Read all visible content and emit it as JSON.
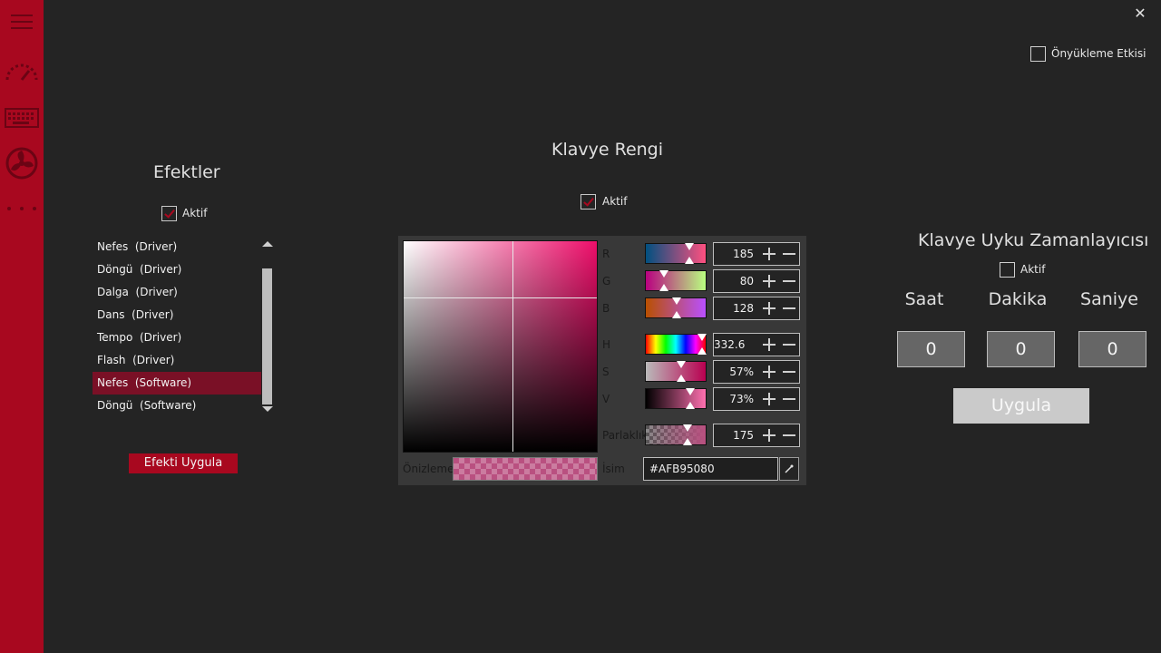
{
  "window": {
    "close_glyph": "✕"
  },
  "sidebar": {
    "icons": [
      "hamburger-menu-icon",
      "speedometer-icon",
      "keyboard-icon",
      "fan-icon",
      "more-dots-icon"
    ],
    "color": "#a8081f"
  },
  "preview_effect": {
    "label": "Önyükleme Etkisi",
    "checked": false
  },
  "effects": {
    "title": "Efektler",
    "active_label": "Aktif",
    "active_checked": true,
    "items": [
      "Nefes  (Driver)",
      "Döngü  (Driver)",
      "Dalga  (Driver)",
      "Dans  (Driver)",
      "Tempo  (Driver)",
      "Flash  (Driver)",
      "Nefes  (Software)",
      "Döngü  (Software)"
    ],
    "selected_index": 6,
    "apply_label": "Efekti Uygula"
  },
  "color_picker": {
    "title": "Klavye Rengi",
    "active_label": "Aktif",
    "active_checked": true,
    "labels": {
      "r": "R",
      "g": "G",
      "b": "B",
      "h": "H",
      "s": "S",
      "v": "V",
      "brightness": "Parlaklık",
      "preview": "Önizleme",
      "name": "İsim"
    },
    "values": {
      "r": "185",
      "g": "80",
      "b": "128",
      "h": "332.6 °",
      "s": "57%",
      "v": "73%",
      "brightness": "175"
    },
    "hex": "#AFB95080",
    "preview_color": "#b95080"
  },
  "sleep_timer": {
    "title": "Klavye Uyku Zamanlayıcısı",
    "active_label": "Aktif",
    "active_checked": false,
    "hour_label": "Saat",
    "minute_label": "Dakika",
    "second_label": "Saniye",
    "hour": "0",
    "minute": "0",
    "second": "0",
    "apply_label": "Uygula"
  }
}
